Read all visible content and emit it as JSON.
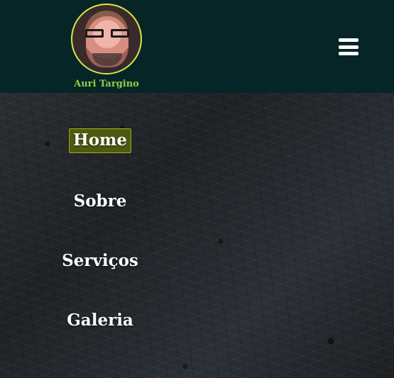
{
  "profile": {
    "name": "Auri Targino"
  },
  "icons": {
    "menu": "hamburger-menu-icon"
  },
  "nav": {
    "items": [
      {
        "label": "Home",
        "active": true
      },
      {
        "label": "Sobre",
        "active": false
      },
      {
        "label": "Serviços",
        "active": false
      },
      {
        "label": "Galeria",
        "active": false
      }
    ]
  },
  "colors": {
    "header_bg": "#062526",
    "profile_name": "#8bd342",
    "active_nav_bg": "#4f5a10",
    "active_nav_border": "#9fb12c",
    "menu_icon": "#ffffff"
  }
}
